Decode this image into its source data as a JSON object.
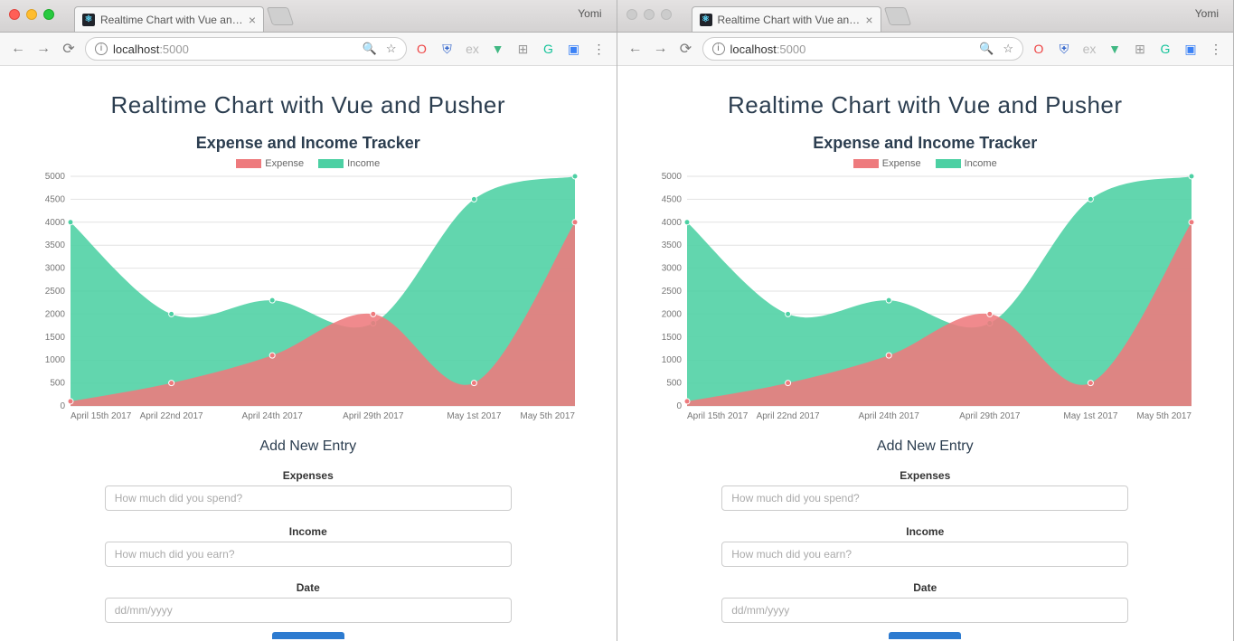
{
  "browser": {
    "tab_title": "Realtime Chart with Vue and P…",
    "profile": "Yomi",
    "url_host": "localhost",
    "url_path": ":5000"
  },
  "page": {
    "title": "Realtime Chart with Vue and Pusher",
    "subtitle": "Expense and Income Tracker",
    "legend_expense": "Expense",
    "legend_income": "Income",
    "form_title": "Add New Entry",
    "expenses_label": "Expenses",
    "expenses_placeholder": "How much did you spend?",
    "income_label": "Income",
    "income_placeholder": "How much did you earn?",
    "date_label": "Date",
    "date_placeholder": "dd/mm/yyyy"
  },
  "chart_data": {
    "type": "area",
    "categories": [
      "April 15th 2017",
      "April 22nd 2017",
      "April 24th 2017",
      "April 29th 2017",
      "May 1st 2017",
      "May 5th 2017"
    ],
    "series": [
      {
        "name": "Income",
        "values": [
          4000,
          2000,
          2300,
          1800,
          4500,
          5000
        ],
        "color": "#4cd0a3"
      },
      {
        "name": "Expense",
        "values": [
          100,
          500,
          1100,
          2000,
          500,
          4000
        ],
        "color": "#ee7a7d"
      }
    ],
    "title": "Expense and Income Tracker",
    "xlabel": "",
    "ylabel": "",
    "ylim": [
      0,
      5000
    ],
    "ytick_step": 500
  }
}
